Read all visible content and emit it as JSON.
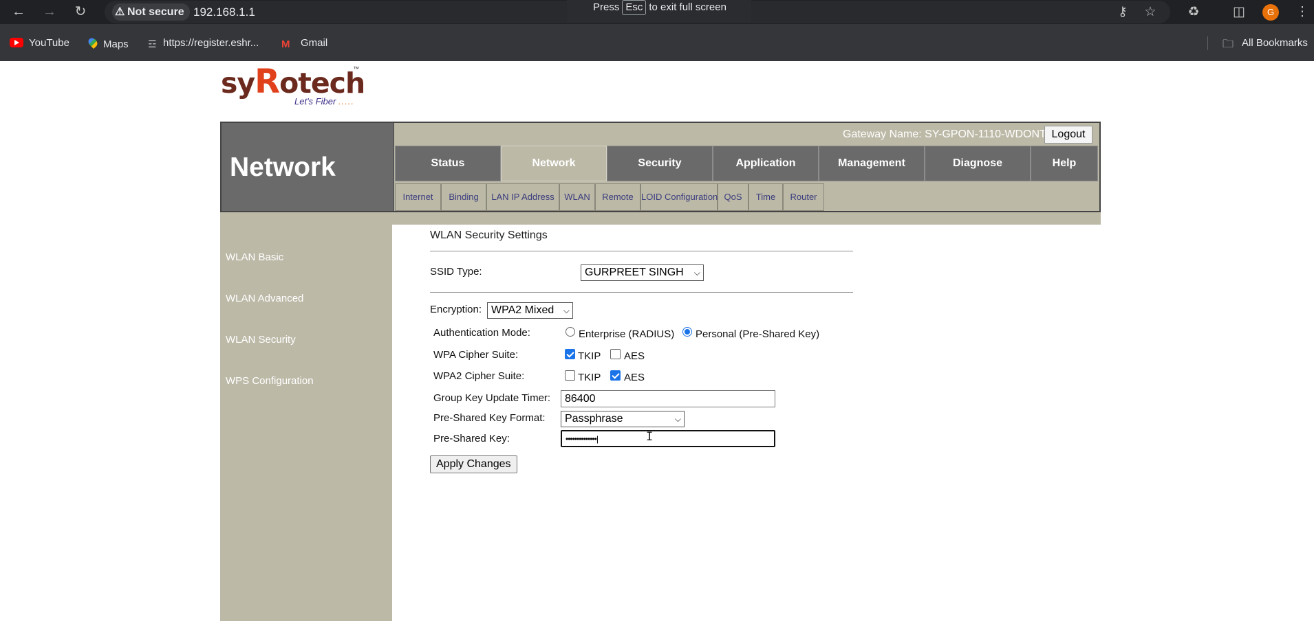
{
  "browser": {
    "security_label": "Not secure",
    "url": "192.168.1.1",
    "fullscreen_msg_pre": "Press",
    "fullscreen_key": "Esc",
    "fullscreen_msg_post": "to exit full screen",
    "profile_initial": "G",
    "bookmarks": [
      {
        "label": "YouTube",
        "icon": "youtube-icon"
      },
      {
        "label": "Maps",
        "icon": "maps-icon"
      },
      {
        "label": "https://register.eshr...",
        "icon": "page-icon"
      },
      {
        "label": "Gmail",
        "icon": "gmail-icon"
      }
    ],
    "all_bookmarks": "All Bookmarks"
  },
  "logo": {
    "brand_start": "sy",
    "brand_r": "R",
    "brand_end": "otech",
    "trademark": "™",
    "tagline": "Let's Fiber",
    "tagline_dots": "....."
  },
  "header": {
    "section_title": "Network",
    "gateway_label": "Gateway Name: SY-GPON-1110-WDONT",
    "logout": "Logout",
    "main_tabs": [
      "Status",
      "Network",
      "Security",
      "Application",
      "Management",
      "Diagnose",
      "Help"
    ],
    "active_tab": "Network",
    "sub_tabs": [
      "Internet",
      "Binding",
      "LAN IP Address",
      "WLAN",
      "Remote",
      "LOID Configuration",
      "QoS",
      "Time",
      "Router"
    ]
  },
  "sidebar": {
    "items": [
      "WLAN Basic",
      "WLAN Advanced",
      "WLAN Security",
      "WPS Configuration"
    ]
  },
  "form": {
    "title": "WLAN Security Settings",
    "ssid_type_label": "SSID Type:",
    "ssid_type_value": "GURPREET SINGH",
    "encryption_label": "Encryption:",
    "encryption_value": "WPA2 Mixed",
    "auth_mode_label": "Authentication Mode:",
    "auth_enterprise": "Enterprise (RADIUS)",
    "auth_personal": "Personal (Pre-Shared Key)",
    "auth_selected": "personal",
    "wpa_cipher_label": "WPA Cipher Suite:",
    "wpa2_cipher_label": "WPA2 Cipher Suite:",
    "tkip": "TKIP",
    "aes": "AES",
    "wpa_tkip_checked": true,
    "wpa_aes_checked": false,
    "wpa2_tkip_checked": false,
    "wpa2_aes_checked": true,
    "group_key_label": "Group Key Update Timer:",
    "group_key_value": "86400",
    "psk_format_label": "Pre-Shared Key Format:",
    "psk_format_value": "Passphrase",
    "psk_label": "Pre-Shared Key:",
    "psk_value": "••••••••••••••|",
    "apply": "Apply Changes"
  }
}
